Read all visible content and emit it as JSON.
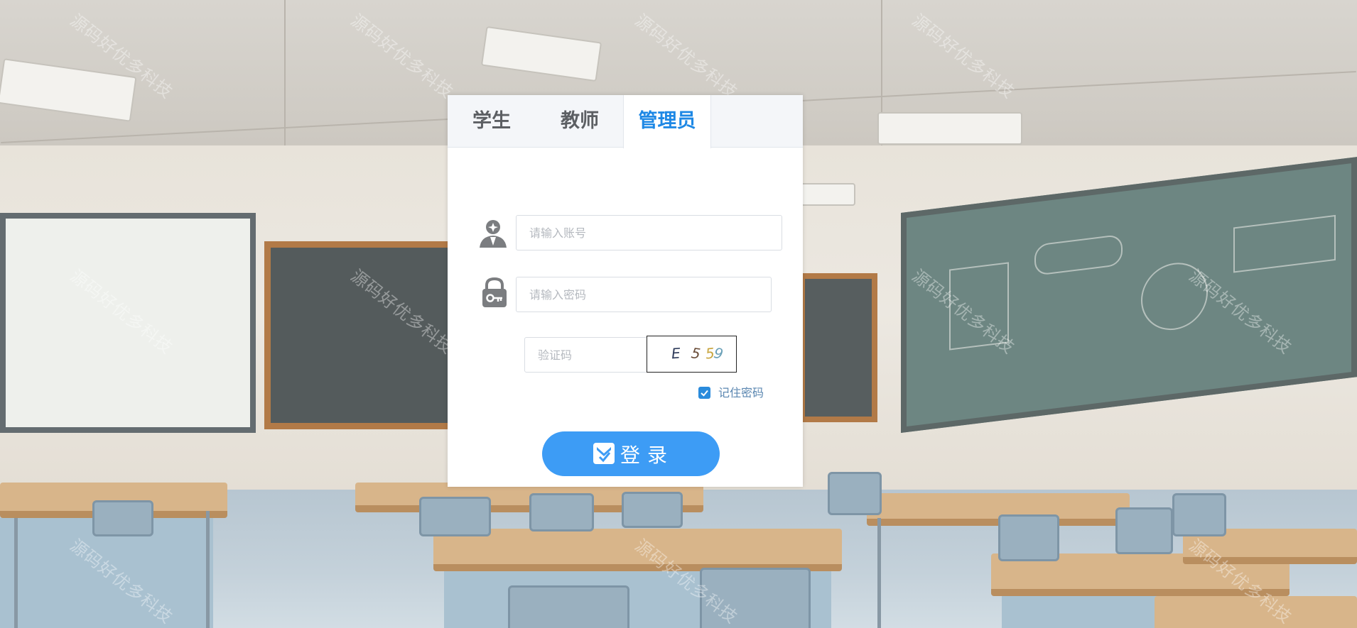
{
  "tabs": [
    {
      "label": "学生",
      "active": false
    },
    {
      "label": "教师",
      "active": false
    },
    {
      "label": "管理员",
      "active": true
    }
  ],
  "form": {
    "account_placeholder": "请输入账号",
    "password_placeholder": "请输入密码",
    "captcha_placeholder": "验证码",
    "captcha_chars": [
      "E",
      "5",
      "5",
      "9"
    ],
    "remember_label": "记住密码",
    "remember_checked": true,
    "login_label": "登录"
  },
  "watermark_text": "源码好优多科技",
  "icons": {
    "account": "user-icon",
    "password": "lock-key-icon",
    "login": "heart-check-icon",
    "checkbox": "check-icon"
  },
  "colors": {
    "accent": "#1e88e5",
    "button": "#3d9cf5",
    "checkbox": "#2a8bdc"
  }
}
